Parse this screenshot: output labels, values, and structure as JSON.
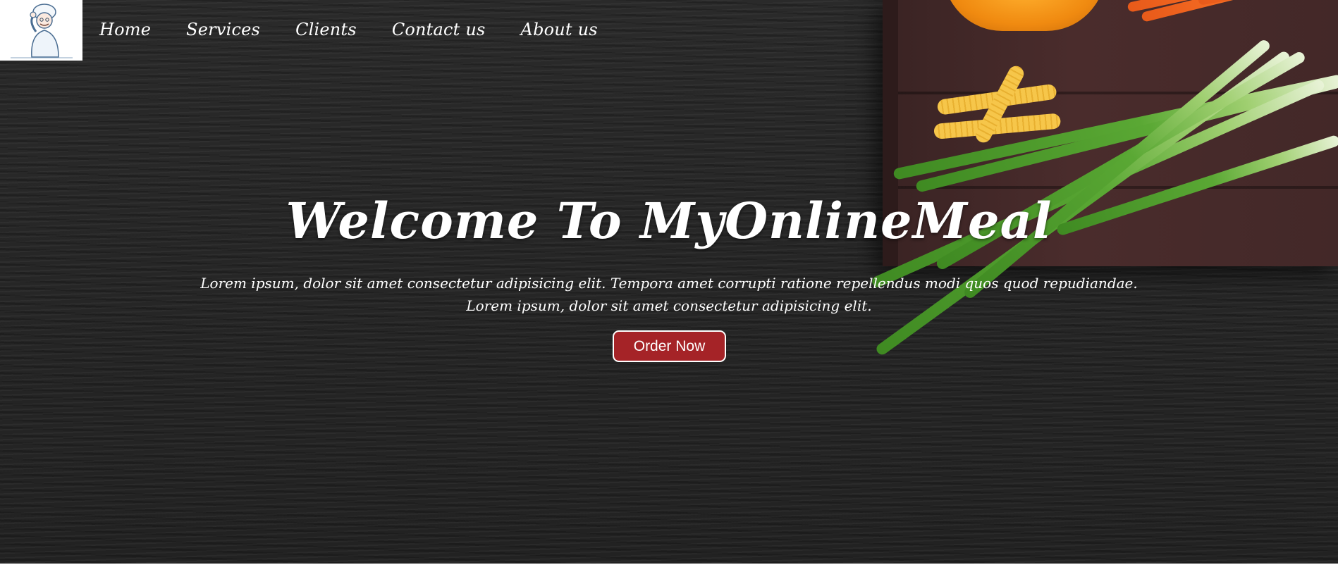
{
  "logo": {
    "icon": "chef-icon"
  },
  "nav": {
    "items": [
      {
        "label": "Home"
      },
      {
        "label": "Services"
      },
      {
        "label": "Clients"
      },
      {
        "label": "Contact us"
      },
      {
        "label": "About us"
      }
    ]
  },
  "hero": {
    "title": "Welcome To MyOnlineMeal",
    "subtitle_line1": "Lorem ipsum, dolor sit amet consectetur adipisicing elit. Tempora amet corrupti ratione repellendus modi quos quod repudiandae.",
    "subtitle_line2": "Lorem ipsum, dolor sit amet consectetur adipisicing elit.",
    "cta_label": "Order Now",
    "background": "food-tray-image"
  },
  "colors": {
    "background": "#242424",
    "button": "#a52327",
    "text": "#ffffff"
  }
}
